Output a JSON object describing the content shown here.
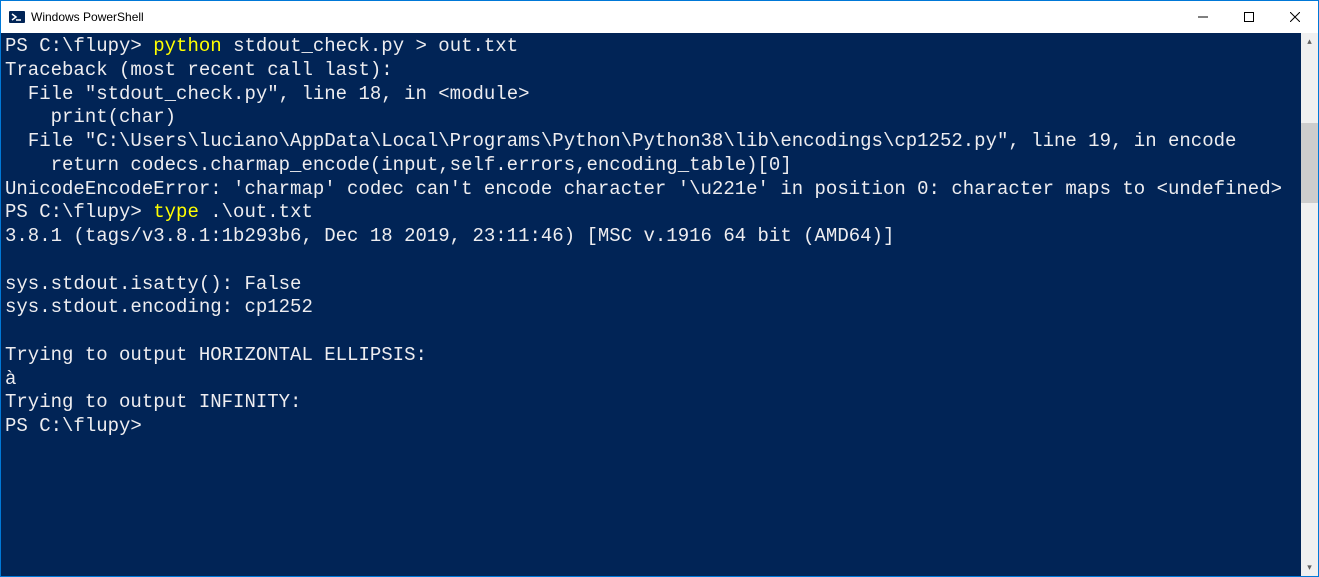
{
  "window": {
    "title": "Windows PowerShell"
  },
  "terminal": {
    "lines": [
      {
        "segments": [
          {
            "cls": "prompt",
            "text": "PS C:\\flupy> "
          },
          {
            "cls": "cmd-yellow",
            "text": "python "
          },
          {
            "cls": "cmd-white",
            "text": "stdout_check.py > out.txt"
          }
        ]
      },
      {
        "segments": [
          {
            "cls": "",
            "text": "Traceback (most recent call last):"
          }
        ]
      },
      {
        "segments": [
          {
            "cls": "",
            "text": "  File \"stdout_check.py\", line 18, in <module>"
          }
        ]
      },
      {
        "segments": [
          {
            "cls": "",
            "text": "    print(char)"
          }
        ]
      },
      {
        "segments": [
          {
            "cls": "",
            "text": "  File \"C:\\Users\\luciano\\AppData\\Local\\Programs\\Python\\Python38\\lib\\encodings\\cp1252.py\", line 19, in encode"
          }
        ]
      },
      {
        "segments": [
          {
            "cls": "",
            "text": "    return codecs.charmap_encode(input,self.errors,encoding_table)[0]"
          }
        ]
      },
      {
        "segments": [
          {
            "cls": "",
            "text": "UnicodeEncodeError: 'charmap' codec can't encode character '\\u221e' in position 0: character maps to <undefined>"
          }
        ]
      },
      {
        "segments": [
          {
            "cls": "prompt",
            "text": "PS C:\\flupy> "
          },
          {
            "cls": "cmd-yellow",
            "text": "type "
          },
          {
            "cls": "cmd-white",
            "text": ".\\out.txt"
          }
        ]
      },
      {
        "segments": [
          {
            "cls": "",
            "text": "3.8.1 (tags/v3.8.1:1b293b6, Dec 18 2019, 23:11:46) [MSC v.1916 64 bit (AMD64)]"
          }
        ]
      },
      {
        "segments": [
          {
            "cls": "",
            "text": ""
          }
        ]
      },
      {
        "segments": [
          {
            "cls": "",
            "text": "sys.stdout.isatty(): False"
          }
        ]
      },
      {
        "segments": [
          {
            "cls": "",
            "text": "sys.stdout.encoding: cp1252"
          }
        ]
      },
      {
        "segments": [
          {
            "cls": "",
            "text": ""
          }
        ]
      },
      {
        "segments": [
          {
            "cls": "",
            "text": "Trying to output HORIZONTAL ELLIPSIS:"
          }
        ]
      },
      {
        "segments": [
          {
            "cls": "",
            "text": "à"
          }
        ]
      },
      {
        "segments": [
          {
            "cls": "",
            "text": "Trying to output INFINITY:"
          }
        ]
      },
      {
        "segments": [
          {
            "cls": "prompt",
            "text": "PS C:\\flupy> "
          }
        ]
      }
    ]
  }
}
